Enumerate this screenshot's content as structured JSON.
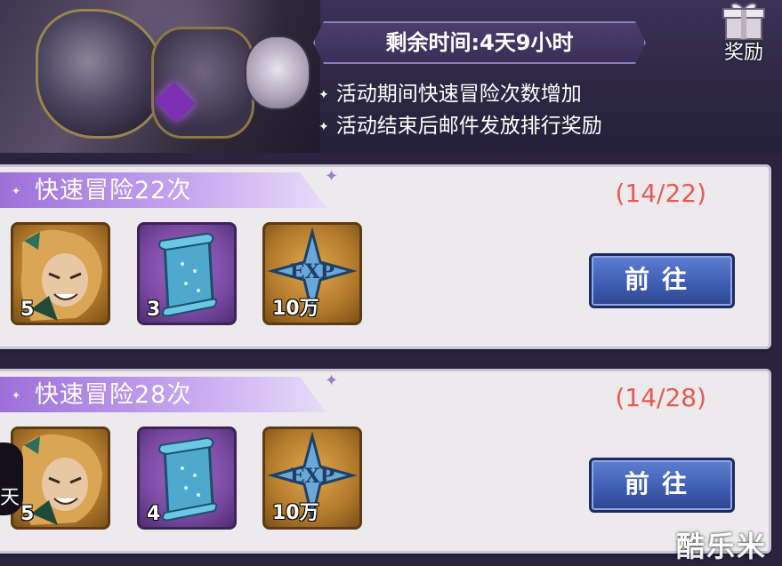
{
  "banner": {
    "timer_text": "剩余时间:4天9小时",
    "reward_label": "奖励",
    "notes": [
      "活动期间快速冒险次数增加",
      "活动结束后邮件发放排行奖励"
    ],
    "note_bullet": "✦"
  },
  "tasks": [
    {
      "title": "快速冒险22次",
      "progress": "(14/22)",
      "items": [
        {
          "icon": "hero-portrait-icon",
          "count": "5",
          "frame": "gold"
        },
        {
          "icon": "scroll-icon",
          "count": "3",
          "frame": "purple"
        },
        {
          "icon": "exp-icon",
          "count": "10万",
          "frame": "gold"
        }
      ],
      "button_label": "前往"
    },
    {
      "title": "快速冒险28次",
      "progress": "(14/28)",
      "items": [
        {
          "icon": "hero-portrait-icon",
          "count": "5",
          "frame": "gold"
        },
        {
          "icon": "scroll-icon",
          "count": "4",
          "frame": "purple"
        },
        {
          "icon": "exp-icon",
          "count": "10万",
          "frame": "gold"
        }
      ],
      "button_label": "前往"
    }
  ],
  "side_chip_text": "天",
  "watermark": "酷乐米",
  "colors": {
    "progress_text": "#e85a4f",
    "header_purple": "#9c6fd8",
    "button_blue": "#3d5bb0"
  }
}
